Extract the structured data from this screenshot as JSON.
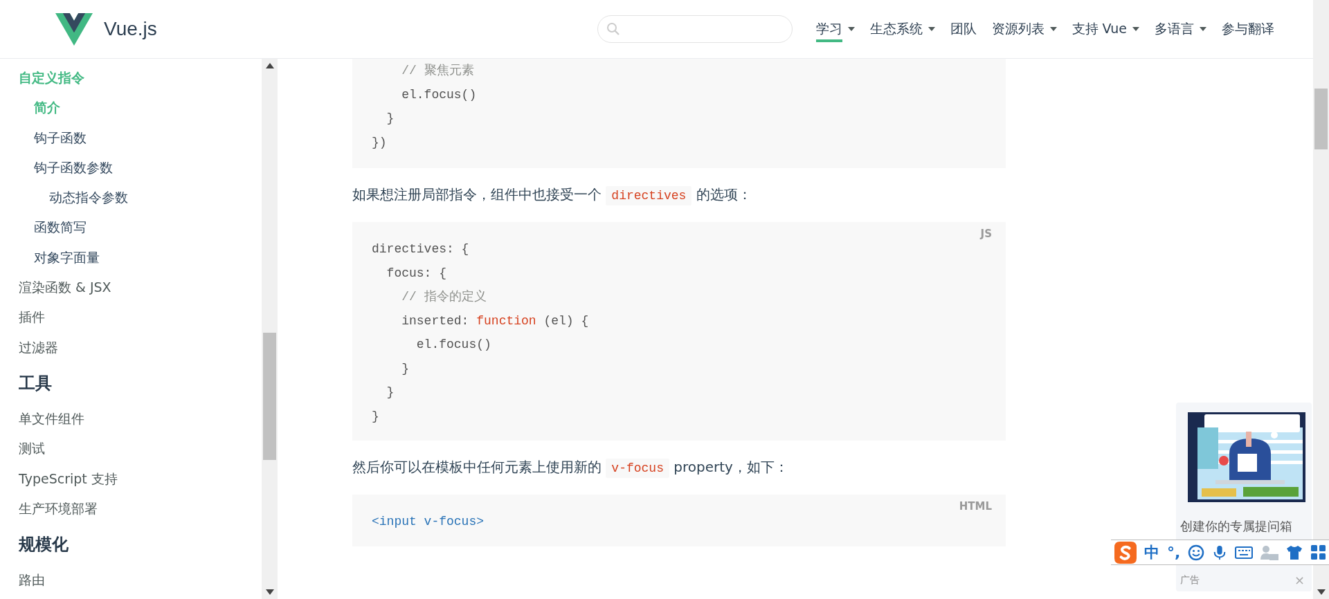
{
  "header": {
    "brand": "Vue.js",
    "nav": [
      {
        "label": "学习",
        "dropdown": true,
        "selected": true
      },
      {
        "label": "生态系统",
        "dropdown": true,
        "selected": false
      },
      {
        "label": "团队",
        "dropdown": false,
        "selected": false
      },
      {
        "label": "资源列表",
        "dropdown": true,
        "selected": false
      },
      {
        "label": "支持 Vue",
        "dropdown": true,
        "selected": false
      },
      {
        "label": "多语言",
        "dropdown": true,
        "selected": false
      },
      {
        "label": "参与翻译",
        "dropdown": false,
        "selected": false
      }
    ]
  },
  "sidebar": {
    "sections": [
      {
        "items": [
          {
            "label": "自定义指令",
            "selected": true,
            "children": [
              {
                "label": "简介",
                "selected": true
              },
              {
                "label": "钩子函数",
                "selected": false
              },
              {
                "label": "钩子函数参数",
                "selected": false,
                "children": [
                  {
                    "label": "动态指令参数",
                    "selected": false
                  }
                ]
              },
              {
                "label": "函数简写",
                "selected": false
              },
              {
                "label": "对象字面量",
                "selected": false
              }
            ]
          },
          {
            "label": "渲染函数 & JSX",
            "selected": false
          },
          {
            "label": "插件",
            "selected": false
          },
          {
            "label": "过滤器",
            "selected": false
          }
        ]
      },
      {
        "heading": "工具",
        "items": [
          {
            "label": "单文件组件",
            "selected": false
          },
          {
            "label": "测试",
            "selected": false
          },
          {
            "label": "TypeScript 支持",
            "selected": false
          },
          {
            "label": "生产环境部署",
            "selected": false
          }
        ]
      },
      {
        "heading": "规模化",
        "items": [
          {
            "label": "路由",
            "selected": false
          }
        ]
      }
    ]
  },
  "content": [
    {
      "kind": "code",
      "lines": [
        [
          {
            "kind": "comment",
            "text": "    // 聚焦元素"
          }
        ],
        [
          {
            "kind": "plain",
            "text": "    el.focus()"
          }
        ],
        [
          {
            "kind": "plain",
            "text": "  }"
          }
        ],
        [
          {
            "kind": "plain",
            "text": "})"
          }
        ]
      ]
    },
    {
      "kind": "paragraph",
      "parts": [
        {
          "kind": "text",
          "text": "如果想注册局部指令，组件中也接受一个 "
        },
        {
          "kind": "code",
          "text": "directives"
        },
        {
          "kind": "text",
          "text": " 的选项："
        }
      ]
    },
    {
      "kind": "code",
      "lang": "JS",
      "lines": [
        [
          {
            "kind": "plain",
            "text": "directives: {"
          }
        ],
        [
          {
            "kind": "plain",
            "text": "  focus: {"
          }
        ],
        [
          {
            "kind": "comment",
            "text": "    // 指令的定义"
          }
        ],
        [
          {
            "kind": "plain",
            "text": "    inserted: "
          },
          {
            "kind": "keyword",
            "text": "function"
          },
          {
            "kind": "plain",
            "text": " (el) {"
          }
        ],
        [
          {
            "kind": "plain",
            "text": "      el.focus()"
          }
        ],
        [
          {
            "kind": "plain",
            "text": "    }"
          }
        ],
        [
          {
            "kind": "plain",
            "text": "  }"
          }
        ],
        [
          {
            "kind": "plain",
            "text": "}"
          }
        ]
      ]
    },
    {
      "kind": "paragraph",
      "parts": [
        {
          "kind": "text",
          "text": "然后你可以在模板中任何元素上使用新的 "
        },
        {
          "kind": "code",
          "text": "v-focus"
        },
        {
          "kind": "text",
          "text": " property，如下："
        }
      ]
    },
    {
      "kind": "code",
      "lang": "HTML",
      "lines": [
        [
          {
            "kind": "tag",
            "text": "<input v-focus>"
          }
        ]
      ]
    }
  ],
  "ad": {
    "kind": "picture",
    "text": "创建你的专属提问箱",
    "label": "广告",
    "close": "×"
  },
  "ime_bar": {
    "mode": "中",
    "punctuation": "°,"
  }
}
